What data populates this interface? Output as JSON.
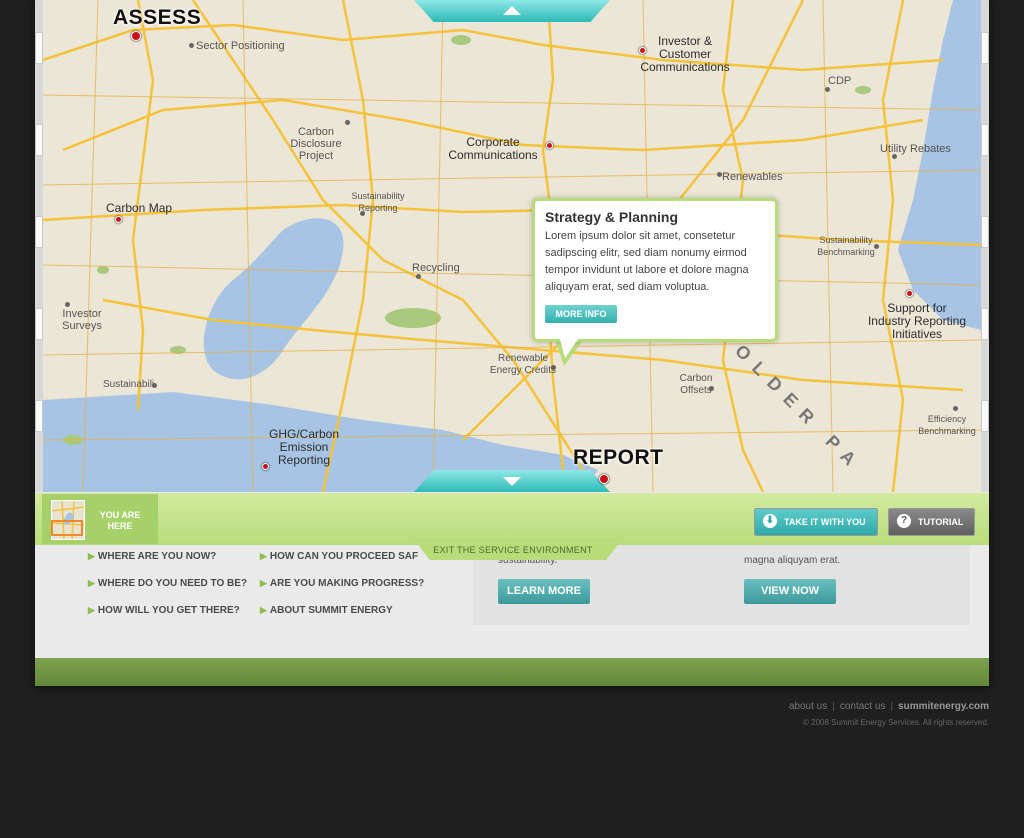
{
  "map": {
    "stages": {
      "assess": "ASSESS",
      "report": "REPORT"
    },
    "labels": [
      {
        "key": "sector",
        "text": "Sector Positioning"
      },
      {
        "key": "investor",
        "text": "Investor &\nCustomer\nCommunications"
      },
      {
        "key": "cdp",
        "text": "CDP"
      },
      {
        "key": "carbon_disclosure",
        "text": "Carbon Disclosure\nProject"
      },
      {
        "key": "corporate",
        "text": "Corporate\nCommunications"
      },
      {
        "key": "utility",
        "text": "Utility Rebates"
      },
      {
        "key": "renewables",
        "text": "Renewables"
      },
      {
        "key": "carbon_map",
        "text": "Carbon Map"
      },
      {
        "key": "sustainability_reporting",
        "text": "Sustainability\nReporting"
      },
      {
        "key": "recycling",
        "text": "Recycling"
      },
      {
        "key": "sustain_bench",
        "text": "Sustainability\nBenchmarking"
      },
      {
        "key": "investor_surveys",
        "text": "Investor\nSurveys"
      },
      {
        "key": "support",
        "text": "Support for\nIndustry Reporting\nInitiatives"
      },
      {
        "key": "renewable_credits",
        "text": "Renewable\nEnergy Credits"
      },
      {
        "key": "carbon_offsets",
        "text": "Carbon\nOffsets"
      },
      {
        "key": "sustainability",
        "text": "Sustainabili"
      },
      {
        "key": "efficiency",
        "text": "Efficiency\nBenchmarking"
      },
      {
        "key": "ghg",
        "text": "GHG/Carbon\nEmission\nReporting"
      }
    ],
    "path_label": "OLDER PA"
  },
  "popup": {
    "title": "Strategy & Planning",
    "body": "Lorem ipsum dolor sit amet, consetetur sadipscing elitr, sed diam nonumy eirmod tempor invidunt ut labore et dolore magna aliquyam erat, sed diam voluptua.",
    "button": "MORE INFO"
  },
  "toolbar": {
    "you_are_here": "YOU ARE HERE",
    "take_it": "TAKE IT WITH YOU",
    "tutorial": "TUTORIAL",
    "exit": "EXIT THE SERVICE ENVIRONMENT"
  },
  "questions": {
    "col1": [
      "WHERE ARE YOU NOW?",
      "WHERE DO YOU NEED TO BE?",
      "HOW WILL YOU GET THERE?"
    ],
    "col2": [
      "HOW CAN YOU PROCEED SAF",
      "ARE YOU MAKING PROGRESS?",
      "ABOUT SUMMIT ENERGY"
    ]
  },
  "content": {
    "left_text": "sustainability.",
    "right_text": "magna aliquyam erat.",
    "learn_more": "LEARN MORE",
    "view_now": "VIEW NOW"
  },
  "footer": {
    "about": "about us",
    "contact": "contact us",
    "brand": "summitenergy.com",
    "copyright": "©  2008 Summit Energy Services.  All rights reserved."
  },
  "colors": {
    "accent": "#3bb5b3",
    "green": "#b9dc7b",
    "pin": "#c8101a"
  }
}
